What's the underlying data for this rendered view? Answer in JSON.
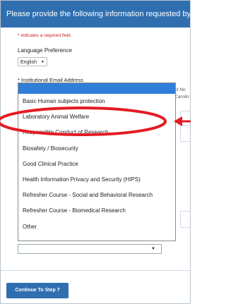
{
  "banner": {
    "text": "Please provide the following information requested by Unive"
  },
  "form": {
    "required_note": "* indicates a required field.",
    "language_label": "Language Preference",
    "language_value": "English",
    "email_label": "* Institutional Email Address",
    "side_text_1": "of No",
    "side_text_2": "Carolin"
  },
  "dropdown": {
    "items": [
      "Basic Human subjects protection",
      "Laboratory Animal Welfare",
      "Responsible Conduct of Research",
      "Biosafety / Biosecurity",
      "Good Clinical Practice",
      "Health Information Privacy and Security (HIPS)",
      "Refresher Course - Social and Behavioral Research",
      "Refresher Course - Biomedical Research",
      "Other"
    ]
  },
  "footer": {
    "continue_label": "Continue To Step 7"
  },
  "colors": {
    "primary": "#2f6fb0",
    "highlight": "#e31b23",
    "selected_row": "#2f7fd8"
  }
}
